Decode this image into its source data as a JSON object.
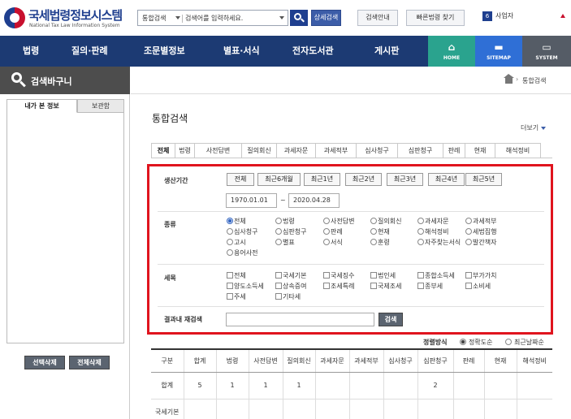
{
  "brand": {
    "title": "국세법령정보시스템",
    "subtitle": "National Tax Law Information System"
  },
  "search": {
    "scope": "통합검색",
    "placeholder": "검색어를 입력하세요."
  },
  "toolbar": {
    "detail_search": "상세검색",
    "guide": "검색안내",
    "quick_find": "빠른법령 찾기",
    "biz_number": "6",
    "biz_label": "사업자"
  },
  "nav": {
    "items": [
      "법령",
      "질의·판례",
      "조문별정보",
      "별표·서식",
      "전자도서관",
      "게시판"
    ],
    "home": "HOME",
    "sitemap": "SITEMAP",
    "system": "SYSTEM"
  },
  "sidebar": {
    "title": "검색바구니",
    "tabs": [
      "내가 본 정보",
      "보관함"
    ],
    "delete_selected": "선택삭제",
    "delete_all": "전체삭제"
  },
  "breadcrumb": {
    "current": "통합검색"
  },
  "main": {
    "title": "통합검색",
    "more": "더보기",
    "tabs": [
      "전체",
      "법령",
      "사전답변",
      "질의회신",
      "과세자문",
      "과세적부",
      "심사청구",
      "심판청구",
      "판례",
      "현재",
      "해석정비"
    ]
  },
  "filter": {
    "period_label": "생산기간",
    "period_buttons": [
      "전체",
      "최근6개월",
      "최근1년",
      "최근2년",
      "최근3년",
      "최근4년",
      "최근5년"
    ],
    "date_from": "1970.01.01",
    "date_to": "2020.04.28",
    "tilde": "~",
    "type_label": "종류",
    "types": [
      "전체",
      "법령",
      "사전답변",
      "질의회신",
      "과세자문",
      "과세적부",
      "심사청구",
      "심판청구",
      "판례",
      "현재",
      "해석정비",
      "세법집행",
      "고시",
      "별표",
      "서식",
      "훈령",
      "자주찾는서식",
      "발간책자",
      "용어사전"
    ],
    "tax_label": "세목",
    "taxes": [
      "전체",
      "국세기본",
      "국세징수",
      "법인세",
      "종합소득세",
      "부가가치",
      "양도소득세",
      "상속증여",
      "조세특례",
      "국제조세",
      "종부세",
      "소비세",
      "주세",
      "기타세"
    ],
    "refine_label": "결과내 재검색",
    "refine_button": "검색"
  },
  "sort": {
    "label": "정렬방식",
    "options": [
      "정확도순",
      "최근날짜순"
    ]
  },
  "table": {
    "headers": [
      "구분",
      "합계",
      "법령",
      "사전답변",
      "질의회신",
      "과세자문",
      "과세적부",
      "심사청구",
      "심판청구",
      "판례",
      "현재",
      "해석정비"
    ],
    "rows": [
      [
        "합계",
        "5",
        "1",
        "1",
        "1",
        "",
        "",
        "",
        "2",
        "",
        "",
        ""
      ],
      [
        "국세기본",
        "",
        "",
        "",
        "",
        "",
        "",
        "",
        "",
        "",
        "",
        ""
      ]
    ]
  }
}
